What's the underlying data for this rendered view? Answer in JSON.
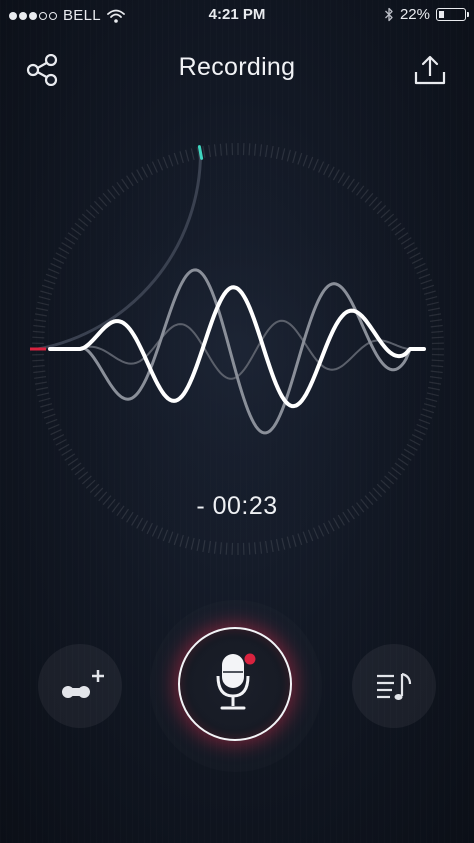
{
  "status_bar": {
    "carrier": "BELL",
    "time": "4:21 PM",
    "battery_percent": "22%",
    "battery_level": 0.22,
    "signal_bars_on": 3,
    "signal_bars_total": 5
  },
  "header": {
    "title": "Recording",
    "left_icon": "share-icon",
    "right_icon": "upload-icon"
  },
  "recorder": {
    "timer": "- 00:23",
    "progress_fraction": 0.22
  },
  "controls": {
    "left_icon": "add-track-icon",
    "center_icon": "microphone-icon",
    "right_icon": "playlist-icon"
  },
  "colors": {
    "accent_red": "#d9233f",
    "accent_teal": "#3fd6c0",
    "wave_primary": "#ffffff",
    "wave_secondary": "#8a8f99"
  }
}
